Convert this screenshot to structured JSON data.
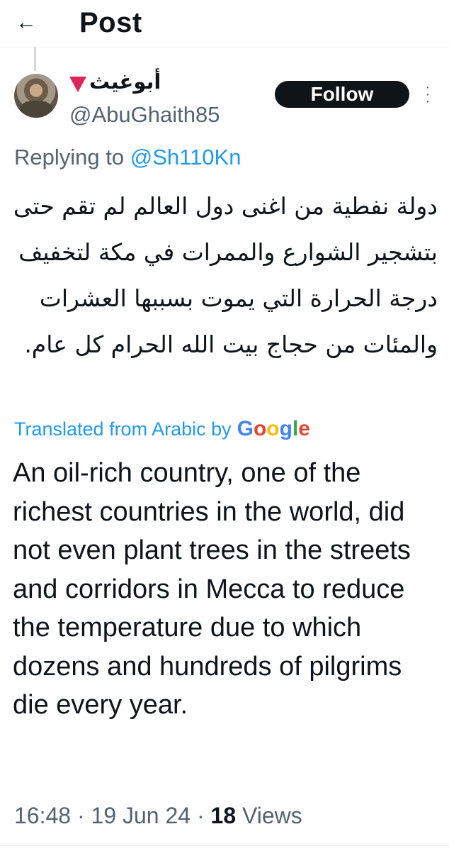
{
  "header": {
    "back_icon": "arrow-left-icon",
    "title": "Post"
  },
  "post": {
    "author_name": "أبوغيث",
    "author_flag_icon": "red-triangle-icon",
    "author_handle": "@AbuGhaith85",
    "follow_label": "Follow",
    "more_icon": "more-vertical-icon",
    "replying_prefix": "Replying to",
    "replying_to": "@Sh110Kn",
    "arabic_text": "دولة نفطية من اغنى دول العالم لم تقم حتى بتشجير الشوارع والممرات في مكة لتخفيف درجة الحرارة التي يموت بسببها العشرات والمئات من حجاج بيت الله الحرام كل عام.",
    "translation_label": "Translated from Arabic by",
    "translation_provider": "Google",
    "english_text": "An oil-rich country, one of the richest countries in the world, did not even plant trees in the streets and corridors in Mecca to reduce the temperature due to which dozens and hundreds of pilgrims die every year.",
    "time": "16:48",
    "date": "19 Jun 24",
    "views_count": "18",
    "views_label": "Views"
  },
  "colors": {
    "accent": "#1d9bf0",
    "secondary_text": "#536471",
    "flag": "#e0245e"
  }
}
